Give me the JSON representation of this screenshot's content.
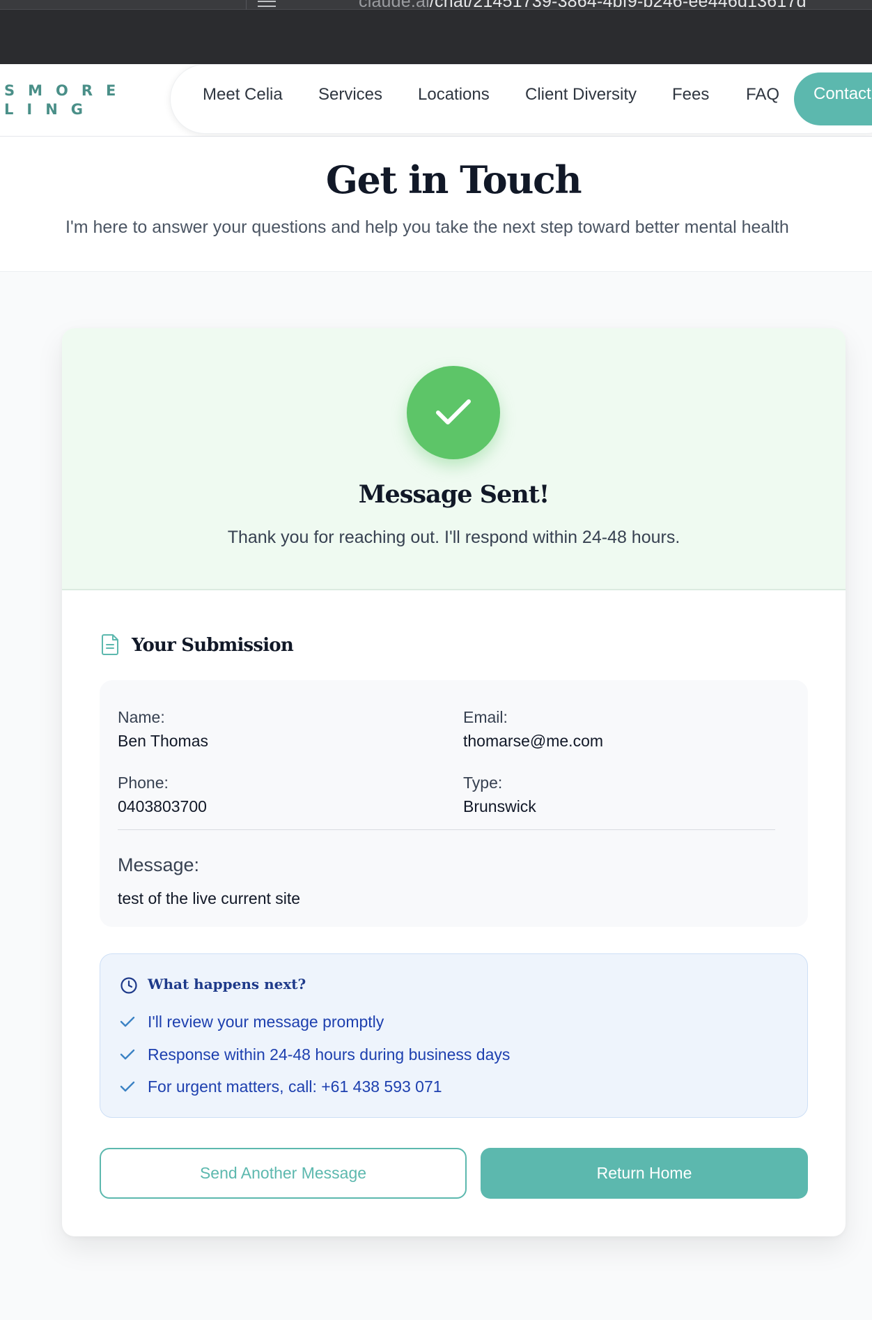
{
  "browser": {
    "url_domain": "claude.ai",
    "url_path": "/chat/21451739-3864-4bf9-b246-ee446d13617d"
  },
  "header": {
    "logo_line1": "SMORE",
    "logo_line2": "LING",
    "nav": {
      "meet": "Meet Celia",
      "services": "Services",
      "locations": "Locations",
      "diversity": "Client Diversity",
      "fees": "Fees",
      "faq": "FAQ",
      "contact": "Contact"
    }
  },
  "hero": {
    "title": "Get in Touch",
    "subtitle": "I'm here to answer your questions and help you take the next step toward better mental health"
  },
  "success": {
    "icon": "check-icon",
    "title": "Message Sent!",
    "text": "Thank you for reaching out. I'll respond within 24-48 hours."
  },
  "submission": {
    "icon": "document-icon",
    "title": "Your Submission",
    "name_label": "Name:",
    "name_value": "Ben Thomas",
    "email_label": "Email:",
    "email_value": "thomarse@me.com",
    "phone_label": "Phone:",
    "phone_value": "0403803700",
    "type_label": "Type:",
    "type_value": "Brunswick",
    "message_label": "Message:",
    "message_value": "test of the live current site"
  },
  "next_steps": {
    "icon": "clock-icon",
    "title": "What happens next?",
    "items": [
      "I'll review your message promptly",
      "Response within 24-48 hours during business days",
      "For urgent matters, call: +61 438 593 071"
    ]
  },
  "actions": {
    "send_another": "Send Another Message",
    "return_home": "Return Home"
  },
  "colors": {
    "accent": "#5cb8ae",
    "success_green": "#5dc568",
    "success_bg": "#effaf1",
    "info_bg": "#eef4fc",
    "info_text": "#1e40af"
  }
}
